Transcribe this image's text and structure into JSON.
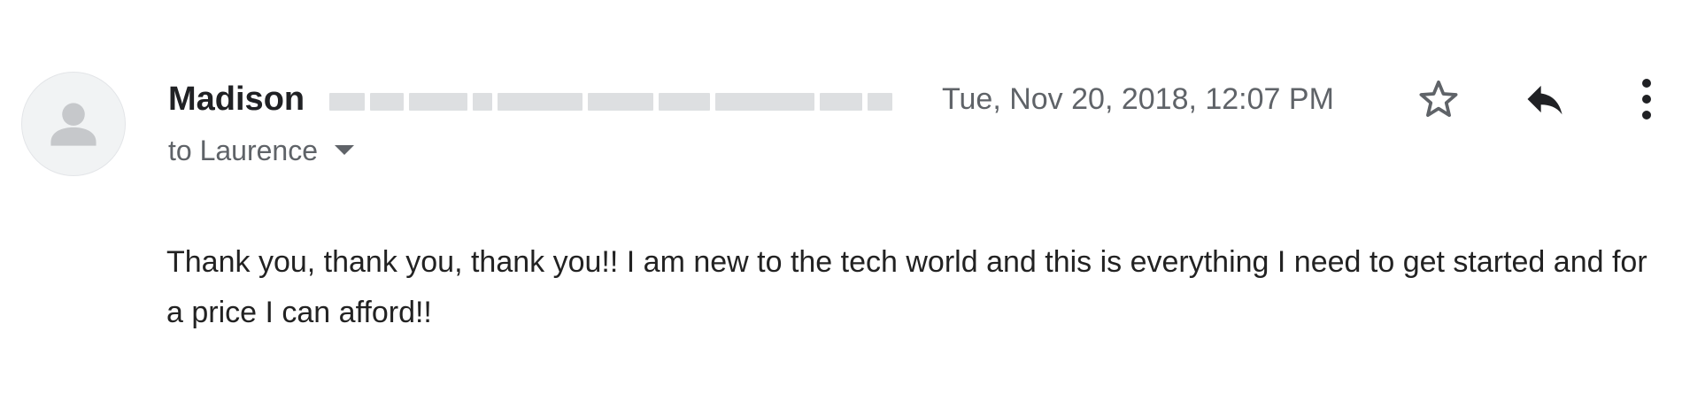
{
  "message": {
    "sender": {
      "name": "Madison",
      "avatar_icon": "person-icon"
    },
    "timestamp": "Tue, Nov 20, 2018, 12:07 PM",
    "recipient": "to Laurence",
    "actions": [
      {
        "name": "star",
        "icon": "star-outline-icon"
      },
      {
        "name": "reply",
        "icon": "reply-arrow-icon"
      },
      {
        "name": "more",
        "icon": "vertical-dots-icon"
      }
    ],
    "body": "Thank you, thank you, thank you!! I am new to the tech world and this is everything I need to get started and for a price I can afford!!"
  },
  "colors": {
    "secondary_text": "#5f6368",
    "body_text": "#222222",
    "avatar_bg": "#f1f3f4",
    "avatar_glyph": "#c6c8cb"
  }
}
